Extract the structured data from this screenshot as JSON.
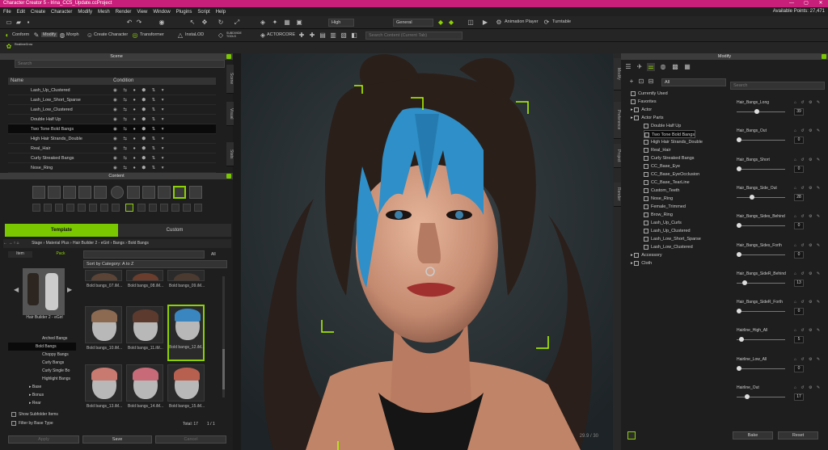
{
  "window": {
    "title": "Character Creator 5 - Irina_CC5_Update.ccProject",
    "controls": [
      "—",
      "▢",
      "✕"
    ]
  },
  "menu": [
    "File",
    "Edit",
    "Create",
    "Character",
    "Modify",
    "Mesh",
    "Render",
    "View",
    "Window",
    "Plugins",
    "Script",
    "Help"
  ],
  "points": "Available Points: 27,471",
  "toolbar": {
    "quality": "High",
    "mode": "General",
    "animation_player": "Animation Player",
    "turntable": "Turntable",
    "search_placeholder": "Search Content (Current Tab)",
    "conform": "Conform",
    "modify": "Modify",
    "morph": "Morph",
    "create_character": "Create Character",
    "transformer": "Transformer",
    "instalod": "InstaLOD",
    "subdivide": "SUBDIVIDE TOOLS",
    "actorcore": "ACTORCORE",
    "realtime_grow": "RealtimeGrow"
  },
  "scene": {
    "title": "Scene",
    "search_placeholder": "Search",
    "col_name": "Name",
    "col_condition": "Condition",
    "rows": [
      "Lash_Up_Clustered",
      "Lash_Low_Short_Sparse",
      "Lash_Low_Clustered",
      "Double Half Up",
      "Two Tone Bold Bangs",
      "High Hair Strands_Double",
      "Real_Hair",
      "Curly Streaked Bangs",
      "Nose_Ring"
    ],
    "selected": 4,
    "side_tabs": [
      "Scene",
      "Visual",
      "Stats"
    ]
  },
  "content": {
    "title": "Content",
    "tab_template": "Template",
    "tab_custom": "Custom",
    "breadcrumb": [
      "Stage",
      "Material Plus",
      "Hair Builder 2 - eGirl",
      "Bangs",
      "Bold Bangs"
    ],
    "side_tab_item": "Item",
    "side_tab_pack": "Pack",
    "pack_caption": "Hair Builder 2 - eGirl",
    "sort": "Sort by Category: A to Z",
    "all": "All",
    "tree": [
      "Arched Bangs",
      "Bold Bangs",
      "Choppy Bangs",
      "Curly Bangs",
      "Curly Single Bo",
      "Highlight Bangs",
      "Base",
      "Bonus",
      "Rear"
    ],
    "tree_selected": 1,
    "thumbs": [
      {
        "label": "Bold bangs_07.iM..."
      },
      {
        "label": "Bold bangs_08.iM..."
      },
      {
        "label": "Bold bangs_09.iM..."
      },
      {
        "label": "Bold bangs_10.iM..."
      },
      {
        "label": "Bold bangs_11.iM..."
      },
      {
        "label": "Bold bangs_12.iM..."
      },
      {
        "label": "Bold bangs_13.iM..."
      },
      {
        "label": "Bold bangs_14.iM..."
      },
      {
        "label": "Bold bangs_15.iM..."
      }
    ],
    "thumb_selected": 5,
    "show_subfolder": "Show Subfolder Items",
    "filter_base": "Filter by Base Type",
    "total": "Total: 17",
    "page": "1 / 1",
    "btn_apply": "Apply",
    "btn_save": "Save",
    "btn_cancel": "Cancel"
  },
  "viewport": {
    "fps": "29.9 / 30"
  },
  "modify": {
    "title": "Modify",
    "filter": "All",
    "search_placeholder": "Search",
    "side_tabs": [
      "Modify",
      "Preference",
      "Project",
      "Render"
    ],
    "tree": [
      {
        "label": "Currently Used",
        "lvl": 0
      },
      {
        "label": "Favorites",
        "lvl": 0
      },
      {
        "label": "Actor",
        "lvl": 0
      },
      {
        "label": "Actor Parts",
        "lvl": 0
      },
      {
        "label": "Double Half Up",
        "lvl": 1
      },
      {
        "label": "Two Tone Bold Bangs",
        "lvl": 1
      },
      {
        "label": "High Hair Strands_Double",
        "lvl": 1
      },
      {
        "label": "Real_Hair",
        "lvl": 1
      },
      {
        "label": "Curly Streaked Bangs",
        "lvl": 1
      },
      {
        "label": "CC_Base_Eye",
        "lvl": 1
      },
      {
        "label": "CC_Base_EyeOcclusion",
        "lvl": 1
      },
      {
        "label": "CC_Base_TearLine",
        "lvl": 1
      },
      {
        "label": "Custom_Teeth",
        "lvl": 1
      },
      {
        "label": "Nose_Ring",
        "lvl": 1
      },
      {
        "label": "Female_Trimmed",
        "lvl": 1
      },
      {
        "label": "Brow_Ring",
        "lvl": 1
      },
      {
        "label": "Lash_Up_Curls",
        "lvl": 1
      },
      {
        "label": "Lash_Up_Clustered",
        "lvl": 1
      },
      {
        "label": "Lash_Low_Short_Sparse",
        "lvl": 1
      },
      {
        "label": "Lash_Low_Clustered",
        "lvl": 1
      },
      {
        "label": "Accessory",
        "lvl": 0
      },
      {
        "label": "Cloth",
        "lvl": 0
      }
    ],
    "tree_selected": 5,
    "sliders": [
      {
        "label": "Hair_Bangs_Long",
        "value": "39",
        "pos": 0.39
      },
      {
        "label": "Hair_Bangs_Out",
        "value": "0",
        "pos": 0
      },
      {
        "label": "Hair_Bangs_Short",
        "value": "0",
        "pos": 0
      },
      {
        "label": "Hair_Bangs_Side_Out",
        "value": "28",
        "pos": 0.28
      },
      {
        "label": "Hair_Bangs_Sides_Behind",
        "value": "0",
        "pos": 0
      },
      {
        "label": "Hair_Bangs_Sides_Forth",
        "value": "0",
        "pos": 0
      },
      {
        "label": "Hair_Bangs_SideR_Behind",
        "value": "13",
        "pos": 0.13
      },
      {
        "label": "Hair_Bangs_SideR_Forth",
        "value": "0",
        "pos": 0
      },
      {
        "label": "Hairline_High_All",
        "value": "5",
        "pos": 0.05
      },
      {
        "label": "Hairline_Low_All",
        "value": "0",
        "pos": 0
      },
      {
        "label": "Hairline_Out",
        "value": "17",
        "pos": 0.17
      }
    ],
    "btn_bake": "Bake",
    "btn_reset": "Reset"
  }
}
